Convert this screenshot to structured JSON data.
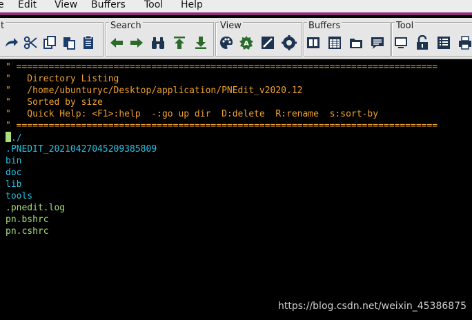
{
  "menubar": {
    "items": [
      "e",
      "Edit",
      "View",
      "Buffers",
      "Tool",
      "Help"
    ]
  },
  "toolbar": {
    "groups": [
      {
        "title": "t",
        "icons": [
          "redo-icon",
          "cut-icon",
          "copy-icon",
          "paste-icon",
          "clipboard-icon"
        ]
      },
      {
        "title": "Search",
        "icons": [
          "arrow-left-icon",
          "arrow-right-icon",
          "binoculars-icon",
          "go-top-icon",
          "go-bottom-icon"
        ]
      },
      {
        "title": "View",
        "icons": [
          "palette-icon",
          "gear-icon",
          "edit-image-icon",
          "settings-icon"
        ]
      },
      {
        "title": "Buffers",
        "icons": [
          "buffer-split-icon",
          "buffer-list-icon",
          "folder-open-icon",
          "comment-icon"
        ]
      },
      {
        "title": "Tool",
        "icons": [
          "monitor-icon",
          "lock-icon",
          "list-icon",
          "print-icon"
        ]
      }
    ]
  },
  "editor": {
    "header_lines": [
      "\" ==============================================================================",
      "\"   Directory Listing",
      "\"   /home/ubunturyc/Desktop/application/PNEdit_v2020.12",
      "\"   Sorted by size",
      "\"   Quick Help: <F1>:help  -:go up dir  D:delete  R:rename  s:sort-by",
      "\" =============================================================================="
    ],
    "current_dir": "./",
    "entries": [
      {
        "name": ".PNEDIT_20210427045209385809",
        "kind": "dir"
      },
      {
        "name": "bin",
        "kind": "dir"
      },
      {
        "name": "doc",
        "kind": "dir"
      },
      {
        "name": "lib",
        "kind": "dir"
      },
      {
        "name": "tools",
        "kind": "dir"
      },
      {
        "name": ".pnedit.log",
        "kind": "file"
      },
      {
        "name": "pn.bshrc",
        "kind": "file"
      },
      {
        "name": "pn.cshrc",
        "kind": "file"
      }
    ]
  },
  "watermark": "https://blog.csdn.net/weixin_45386875",
  "colors": {
    "menubar_accent": "#8e2f7a",
    "header": "#f0a22d",
    "directory": "#25c4e6",
    "file": "#a8df7a"
  }
}
